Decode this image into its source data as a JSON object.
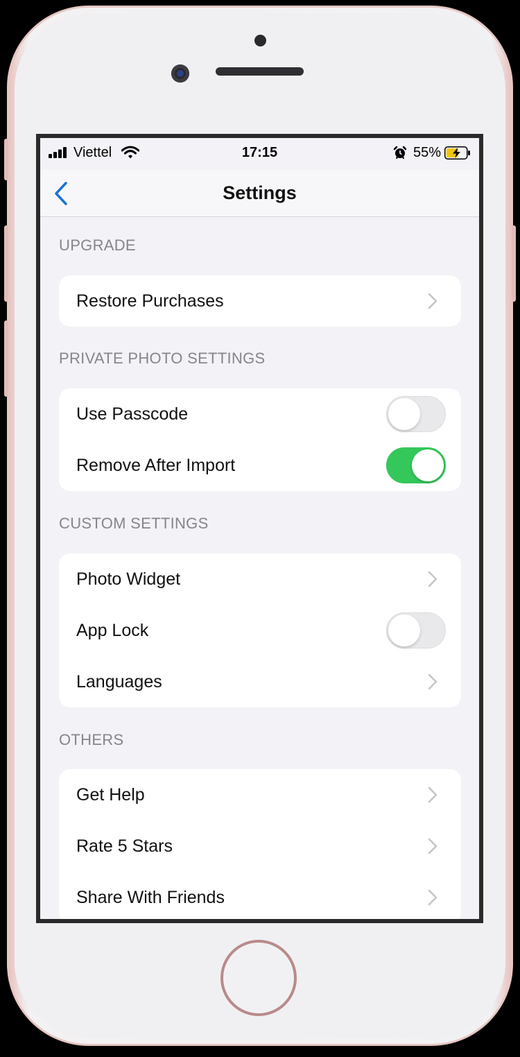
{
  "status_bar": {
    "carrier": "Viettel",
    "time": "17:15",
    "battery_percent": "55%",
    "signal_icon": "signal-bars-icon",
    "wifi_icon": "wifi-icon",
    "alarm_icon": "alarm-icon",
    "battery_icon": "battery-charging-icon"
  },
  "nav": {
    "title": "Settings",
    "back_icon": "chevron-left-icon"
  },
  "sections": [
    {
      "header": "UPGRADE",
      "rows": [
        {
          "label": "Restore Purchases",
          "type": "disclosure"
        }
      ]
    },
    {
      "header": "PRIVATE PHOTO SETTINGS",
      "rows": [
        {
          "label": "Use Passcode",
          "type": "toggle",
          "on": false
        },
        {
          "label": "Remove After Import",
          "type": "toggle",
          "on": true
        }
      ]
    },
    {
      "header": "CUSTOM SETTINGS",
      "rows": [
        {
          "label": "Photo Widget",
          "type": "disclosure"
        },
        {
          "label": "App Lock",
          "type": "toggle",
          "on": false
        },
        {
          "label": "Languages",
          "type": "disclosure"
        }
      ]
    },
    {
      "header": "OTHERS",
      "rows": [
        {
          "label": "Get Help",
          "type": "disclosure"
        },
        {
          "label": "Rate 5 Stars",
          "type": "disclosure"
        },
        {
          "label": "Share With Friends",
          "type": "disclosure"
        }
      ]
    }
  ],
  "colors": {
    "accent": "#1c6fd8",
    "toggle_on": "#34c759",
    "background": "#f2f2f7",
    "section_header": "#85858a"
  }
}
